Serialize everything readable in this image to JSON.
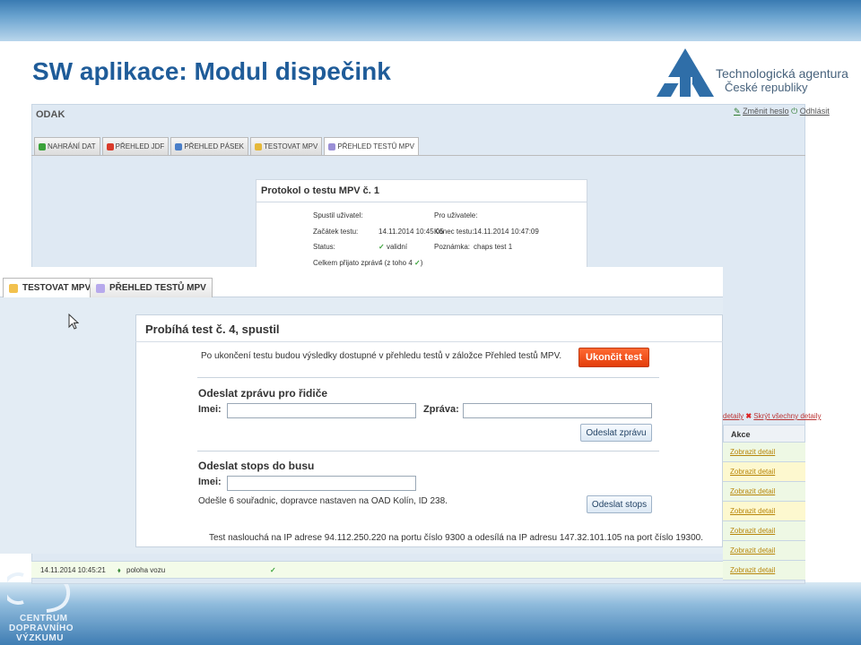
{
  "slide": {
    "title": "SW aplikace: Modul dispečink",
    "ta_logo": {
      "line1": "Technologická agentura",
      "line2": "České republiky"
    },
    "cdv_logo": {
      "line1": "CENTRUM",
      "line2": "DOPRAVNÍHO",
      "line3": "VÝZKUMU"
    }
  },
  "background_app": {
    "name": "ODAK",
    "links": [
      "Změnit heslo",
      "Odhlásit"
    ],
    "tabs": [
      {
        "label": "NAHRÁNÍ DAT",
        "color": "#3aa23a"
      },
      {
        "label": "PŘEHLED JDF",
        "color": "#d93a2a"
      },
      {
        "label": "PŘEHLED PÁSEK",
        "color": "#4a7fc9"
      },
      {
        "label": "TESTOVAT MPV",
        "color": "#e5b83a"
      },
      {
        "label": "PŘEHLED TESTŮ MPV",
        "color": "#9a8fd6"
      }
    ],
    "protocol": {
      "title": "Protokol o testu MPV č. 1",
      "rows": [
        {
          "label": "Spustil uživatel:",
          "value": "",
          "label2": "Pro uživatele:",
          "value2": ""
        },
        {
          "label": "Začátek testu:",
          "value": "14.11.2014 10:45:05",
          "label2": "Konec testu:",
          "value2": "14.11.2014 10:47:09"
        },
        {
          "label": "Status:",
          "value": "validní",
          "label2": "Poznámka:",
          "value2": "chaps test 1"
        },
        {
          "label": "Celkem přijato zpráv:",
          "value": "4 (z toho 4",
          "label2": "",
          "value2": ""
        }
      ]
    },
    "bar_links": [
      "detaily",
      "Skrýt všechny detaily"
    ],
    "akce_header": "Akce",
    "akce_link": "Zobrazit detail",
    "bottom_row": {
      "time": "14.11.2014 10:45:21",
      "label": "poloha vozu"
    }
  },
  "foreground": {
    "tabs": [
      {
        "label": "TESTOVAT MPV",
        "color": "#f2c14e"
      },
      {
        "label": "PŘEHLED TESTŮ MPV",
        "color": "#b7a9ec"
      }
    ],
    "panel_title": "Probíhá test č. 4, spustil",
    "info_text": "Po ukončení testu budou výsledky dostupné v přehledu testů v záložce Přehled testů MPV.",
    "end_button": "Ukončit test",
    "message_section": {
      "heading": "Odeslat zprávu pro řidiče",
      "imei_label": "Imei:",
      "imei_value": "",
      "message_label": "Zpráva:",
      "message_value": "",
      "send_button": "Odeslat zprávu"
    },
    "stops_section": {
      "heading": "Odeslat stops do busu",
      "imei_label": "Imei:",
      "imei_value": "",
      "info": "Odešle 6 souřadnic, dopravce nastaven na OAD Kolín, ID 238.",
      "send_button": "Odeslat stops"
    },
    "footer_text": "Test naslouchá na IP adrese 94.112.250.220 na portu číslo 9300 a odesílá na IP adresu 147.32.101.105 na port číslo 19300."
  }
}
